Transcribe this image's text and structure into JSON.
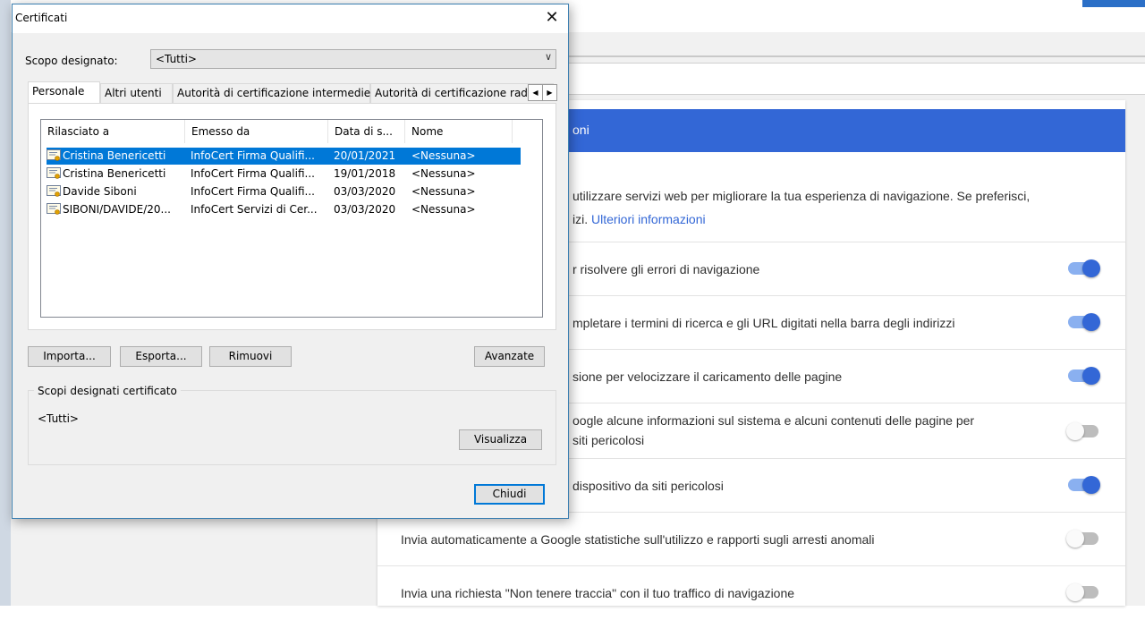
{
  "dialog": {
    "title": "Certificati",
    "close_glyph": "✕",
    "scope_label": "Scopo designato:",
    "scope_value": "<Tutti>",
    "tabs": [
      {
        "label": "Personale"
      },
      {
        "label": "Altri utenti"
      },
      {
        "label": "Autorità di certificazione intermedie"
      },
      {
        "label": "Autorità di certificazione radice attendibili"
      }
    ],
    "columns": [
      "Rilasciato a",
      "Emesso da",
      "Data di s...",
      "Nome"
    ],
    "rows": [
      {
        "issued_to": "Cristina Benericetti",
        "issued_by": "InfoCert Firma Qualifi...",
        "date": "20/01/2021",
        "name": "<Nessuna>"
      },
      {
        "issued_to": "Cristina Benericetti",
        "issued_by": "InfoCert Firma Qualifi...",
        "date": "19/01/2018",
        "name": "<Nessuna>"
      },
      {
        "issued_to": "Davide Siboni",
        "issued_by": "InfoCert Firma Qualifi...",
        "date": "03/03/2020",
        "name": "<Nessuna>"
      },
      {
        "issued_to": "SIBONI/DAVIDE/20...",
        "issued_by": "InfoCert Servizi di Cer...",
        "date": "03/03/2020",
        "name": "<Nessuna>"
      }
    ],
    "buttons": {
      "import": "Importa...",
      "export": "Esporta...",
      "remove": "Rimuovi",
      "advanced": "Avanzate",
      "view": "Visualizza",
      "close": "Chiudi"
    },
    "purposes_group_title": "Scopi designati certificato",
    "purposes_value": "<Tutti>"
  },
  "background": {
    "header_title": "oni",
    "description": "utilizzare servizi web per migliorare la tua esperienza di navigazione. Se preferisci,",
    "description_line2": "izi.",
    "description_link": "Ulteriori informazioni",
    "settings": [
      {
        "label": "r risolvere gli errori di navigazione",
        "on": true
      },
      {
        "label": "mpletare i termini di ricerca e gli URL digitati nella barra degli indirizzi",
        "on": true
      },
      {
        "label": "sione per velocizzare il caricamento delle pagine",
        "on": true
      },
      {
        "label": "oogle alcune informazioni sul sistema e alcuni contenuti delle pagine per",
        "label_line2": "siti pericolosi",
        "on": false
      },
      {
        "label": "dispositivo da siti pericolosi",
        "on": true
      },
      {
        "label": "Invia automaticamente a Google statistiche sull'utilizzo e rapporti sugli arresti anomali",
        "on": false
      },
      {
        "label": "Invia una richiesta \"Non tenere traccia\" con il tuo traffico di navigazione",
        "on": false
      }
    ]
  },
  "colors": {
    "accent": "#3367d6",
    "selection": "#0078d7",
    "toggle_on": "#3367d6",
    "toggle_off": "#bdbdbd"
  }
}
